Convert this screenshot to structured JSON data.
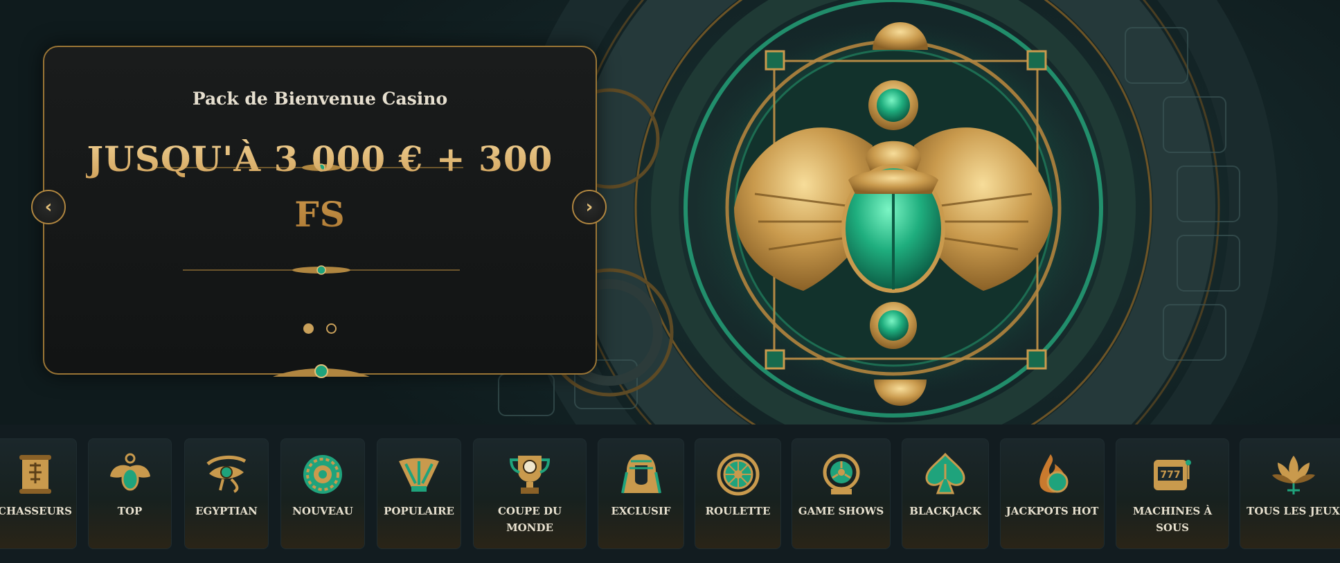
{
  "promo": {
    "subtitle": "Pack de Bienvenue Casino",
    "title": "JUSQU'À 3 000 € + 300 FS",
    "prev_icon": "chevron-left-icon",
    "next_icon": "chevron-right-icon",
    "slides_total": 2,
    "slide_active": 1
  },
  "hero": {
    "artwork": "golden-scarab-emblem",
    "glow_color": "#2fd69a"
  },
  "colors": {
    "gold": "#c9a05a",
    "emerald": "#1fa37c",
    "background": "#121c20"
  },
  "categories": [
    {
      "label": "CHASSEURS",
      "icon": "scroll-icon"
    },
    {
      "label": "TOP",
      "icon": "scarab-icon"
    },
    {
      "label": "EGYPTIAN",
      "icon": "eye-of-horus-icon"
    },
    {
      "label": "NOUVEAU",
      "icon": "sun-disc-icon"
    },
    {
      "label": "POPULAIRE",
      "icon": "lotus-fan-icon"
    },
    {
      "label": "COUPE DU MONDE",
      "icon": "trophy-icon"
    },
    {
      "label": "EXCLUSIF",
      "icon": "pharaoh-mask-icon"
    },
    {
      "label": "ROULETTE",
      "icon": "roulette-wheel-icon"
    },
    {
      "label": "GAME SHOWS",
      "icon": "wheel-show-icon"
    },
    {
      "label": "BLACKJACK",
      "icon": "spade-icon"
    },
    {
      "label": "JACKPOTS HOT",
      "icon": "flame-icon"
    },
    {
      "label": "MACHINES À SOUS",
      "icon": "slot-machine-icon"
    },
    {
      "label": "TOUS LES JEUX",
      "icon": "lotus-flower-icon"
    }
  ]
}
